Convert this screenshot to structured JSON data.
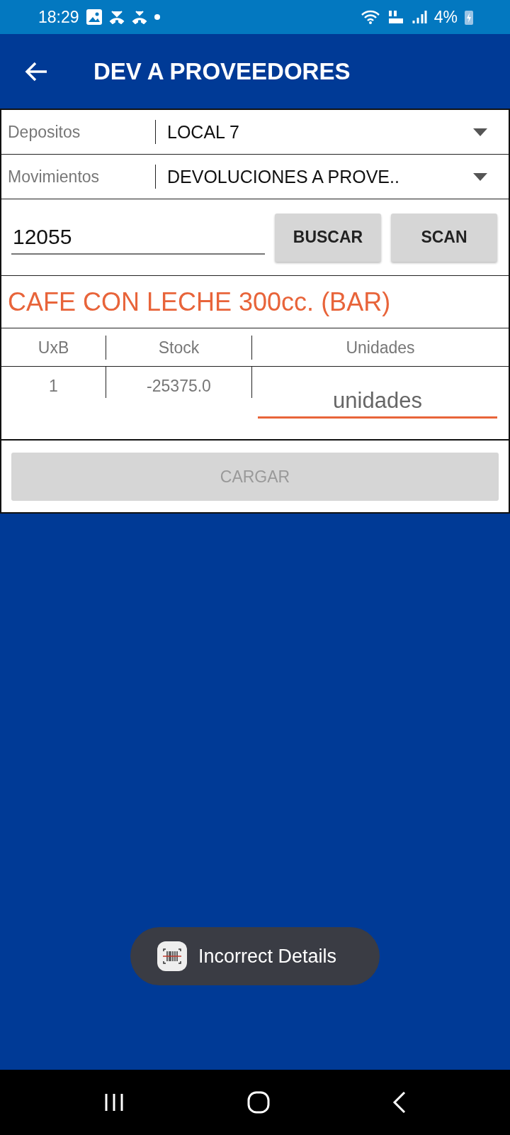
{
  "status_bar": {
    "time": "18:29",
    "battery": "4%"
  },
  "app_bar": {
    "title": "DEV A PROVEEDORES"
  },
  "selectors": [
    {
      "label": "Depositos",
      "value": "LOCAL 7"
    },
    {
      "label": "Movimientos",
      "value": "DEVOLUCIONES A PROVE.."
    }
  ],
  "search": {
    "value": "12055",
    "buttons": [
      "BUSCAR",
      "SCAN"
    ]
  },
  "product": {
    "name": "CAFE CON LECHE 300cc. (BAR)"
  },
  "table": {
    "columns": [
      "UxB",
      "Stock",
      "Unidades"
    ],
    "rows": [
      {
        "uxb": "1",
        "stock": "-25375.0",
        "units_placeholder": "unidades"
      }
    ]
  },
  "load_button": {
    "label": "CARGAR",
    "disabled": true
  },
  "toast": {
    "text": "Incorrect Details"
  }
}
